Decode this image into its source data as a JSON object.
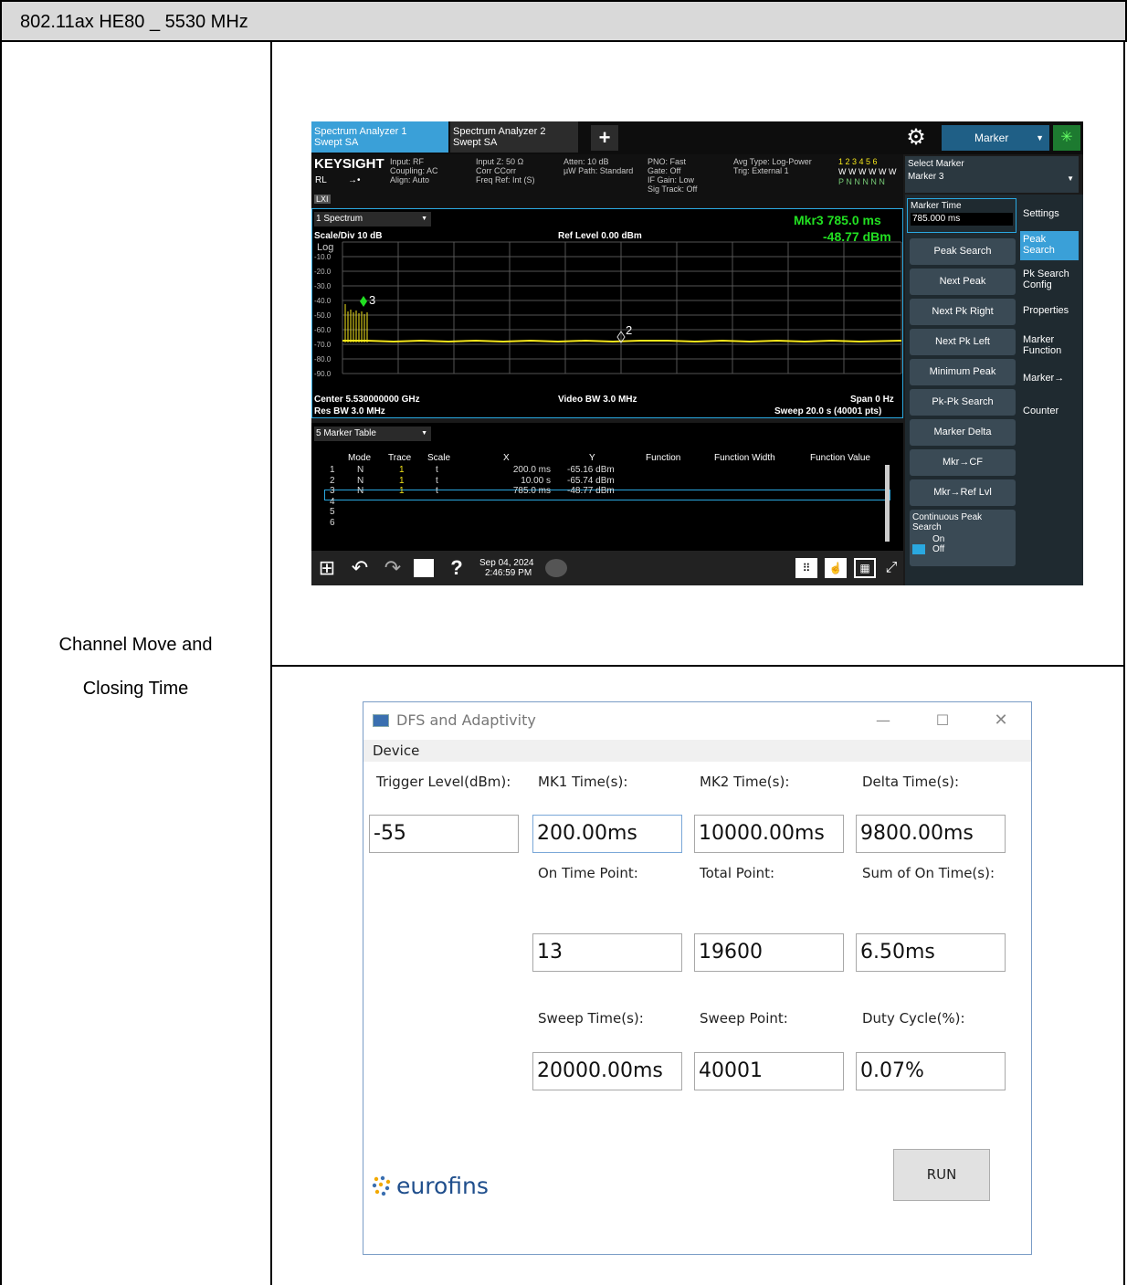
{
  "header": {
    "title": "802.11ax HE80 _ 5530 MHz"
  },
  "row_label": {
    "line1": "Channel Move and",
    "line2": "Closing Time"
  },
  "analyzer": {
    "tabs": [
      {
        "line1": "Spectrum Analyzer 1",
        "line2": "Swept SA"
      },
      {
        "line1": "Spectrum Analyzer 2",
        "line2": "Swept SA"
      }
    ],
    "add_tab": "+",
    "mode_label": "Marker",
    "brand": "KEYSIGHT",
    "rl": "RL",
    "lxi": "LXI",
    "input_col1": [
      "Input: RF",
      "Coupling: AC",
      "Align: Auto"
    ],
    "input_col2": [
      "Input Z: 50 Ω",
      "Corr CCorr",
      "Freq Ref: Int (S)"
    ],
    "input_col3": [
      "Atten: 10 dB",
      "µW Path: Standard"
    ],
    "input_col4": [
      "PNO: Fast",
      "Gate: Off",
      "IF Gain: Low",
      "Sig Track: Off"
    ],
    "input_col5": [
      "Avg Type: Log-Power",
      "Trig: External 1"
    ],
    "trace_row1": "1 2 3 4 5 6",
    "trace_row2": "W W W W W W",
    "trace_row3": "P N N N N N",
    "select_marker_label": "Select Marker",
    "select_marker_value": "Marker 3",
    "view1": "1 Spectrum",
    "scale_div": "Scale/Div 10 dB",
    "log": "Log",
    "ref_level": "Ref Level 0.00 dBm",
    "mkr_readout_line1": "Mkr3  785.0 ms",
    "mkr_readout_line2": "-48.77 dBm",
    "y_ticks": [
      "-10.0",
      "-20.0",
      "-30.0",
      "-40.0",
      "-50.0",
      "-60.0",
      "-70.0",
      "-80.0",
      "-90.0"
    ],
    "marker_labels": [
      "3",
      "2"
    ],
    "center": "Center 5.530000000 GHz",
    "res_bw": "Res BW 3.0 MHz",
    "video_bw": "Video BW 3.0 MHz",
    "span": "Span 0 Hz",
    "sweep": "Sweep 20.0 s (40001 pts)",
    "view5": "5 Marker Table",
    "table_headers": [
      "Mode",
      "Trace",
      "Scale",
      "X",
      "Y",
      "Function",
      "Function Width",
      "Function Value"
    ],
    "table_rows": [
      [
        "1",
        "N",
        "1",
        "t",
        "200.0 ms",
        "-65.16 dBm"
      ],
      [
        "2",
        "N",
        "1",
        "t",
        "10.00 s",
        "-65.74 dBm"
      ],
      [
        "3",
        "N",
        "1",
        "t",
        "785.0 ms",
        "-48.77 dBm"
      ],
      [
        "4",
        "",
        "",
        "",
        "",
        ""
      ],
      [
        "5",
        "",
        "",
        "",
        "",
        ""
      ],
      [
        "6",
        "",
        "",
        "",
        "",
        ""
      ]
    ],
    "marker_time_label": "Marker Time",
    "marker_time_value": "785.000 ms",
    "softkeys": [
      "Peak Search",
      "Next Peak",
      "Next Pk Right",
      "Next Pk Left",
      "Minimum Peak",
      "Pk-Pk Search",
      "Marker Delta",
      "Mkr→CF",
      "Mkr→Ref Lvl"
    ],
    "continuous_label": "Continuous Peak Search",
    "continuous_on": "On",
    "continuous_off": "Off",
    "side_menu": [
      "Settings",
      "Peak Search",
      "Pk Search Config",
      "Properties",
      "Marker Function",
      "Marker→",
      "Counter"
    ],
    "date_line1": "Sep 04, 2024",
    "date_line2": "2:46:59 PM",
    "colors": {
      "trace": "#f5e61b",
      "readout": "#22e022",
      "accent": "#2aa8e0",
      "tab_active": "#3aa0d8"
    }
  },
  "dfs": {
    "title": "DFS and Adaptivity",
    "menu": "Device",
    "labels": {
      "trigger": "Trigger Level(dBm):",
      "mk1": "MK1 Time(s):",
      "mk2": "MK2 Time(s):",
      "delta": "Delta Time(s):",
      "on_point": "On Time Point:",
      "total_point": "Total Point:",
      "sum_on": "Sum of On Time(s):",
      "sweep_time": "Sweep Time(s):",
      "sweep_point": "Sweep Point:",
      "duty": "Duty Cycle(%):"
    },
    "values": {
      "trigger": "-55",
      "mk1": "200.00ms",
      "mk2": "10000.00ms",
      "delta": "9800.00ms",
      "on_point": "13",
      "total_point": "19600",
      "sum_on": "6.50ms",
      "sweep_time": "20000.00ms",
      "sweep_point": "40001",
      "duty": "0.07%"
    },
    "run_label": "RUN",
    "logo_text": "eurofins"
  }
}
